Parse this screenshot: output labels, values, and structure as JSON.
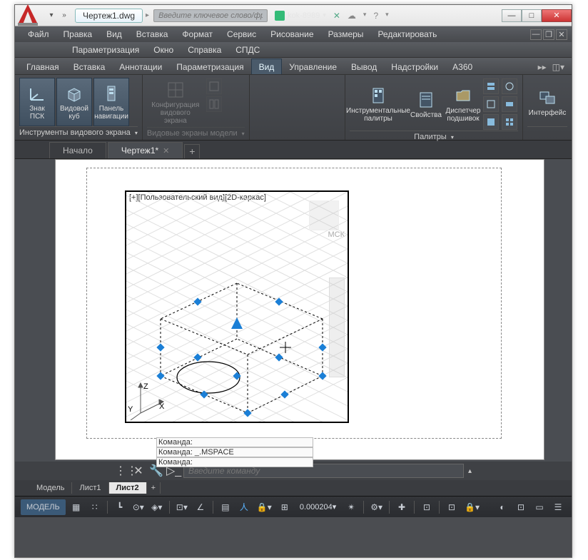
{
  "title": {
    "filename": "Чертеж1.dwg",
    "search_placeholder": "Введите ключевое слово/фразу",
    "username": "kok-8989"
  },
  "menu": {
    "m0": "Файл",
    "m1": "Правка",
    "m2": "Вид",
    "m3": "Вставка",
    "m4": "Формат",
    "m5": "Сервис",
    "m6": "Рисование",
    "m7": "Размеры",
    "m8": "Редактировать",
    "m9": "Параметризация",
    "m10": "Окно",
    "m11": "Справка",
    "m12": "СПДС"
  },
  "ribtabs": {
    "t0": "Главная",
    "t1": "Вставка",
    "t2": "Аннотации",
    "t3": "Параметризация",
    "t4": "Вид",
    "t5": "Управление",
    "t6": "Вывод",
    "t7": "Надстройки",
    "t8": "A360"
  },
  "ribbon": {
    "p1": {
      "b0": "Знак ПСК",
      "b1": "Видовой куб",
      "b2": "Панель навигации",
      "label": "Инструменты видового экрана"
    },
    "p2": {
      "b0": "Конфигурация видового экрана",
      "label": "Видовые экраны модели"
    },
    "p3": {
      "b0": "Инструментальные палитры",
      "b1": "Свойства",
      "b2": "Диспетчер подшивок",
      "label": "Палитры"
    },
    "p4": {
      "b0": "Интерфейс"
    }
  },
  "doctabs": {
    "t0": "Начало",
    "t1": "Чертеж1*"
  },
  "viewport": {
    "label": "[+][Пользовательский вид][2D-каркас]",
    "coord": "МСК",
    "axisZ": "Z",
    "axisY": "Y",
    "axisX": "X"
  },
  "cmdhist": {
    "l0": "Команда:",
    "l1": "Команда: _.MSPACE",
    "l2": "Команда:"
  },
  "cmdline": {
    "placeholder": "Введите команду"
  },
  "layouts": {
    "t0": "Модель",
    "t1": "Лист1",
    "t2": "Лист2"
  },
  "status": {
    "model": "МОДЕЛЬ",
    "coord": "0.000204"
  }
}
